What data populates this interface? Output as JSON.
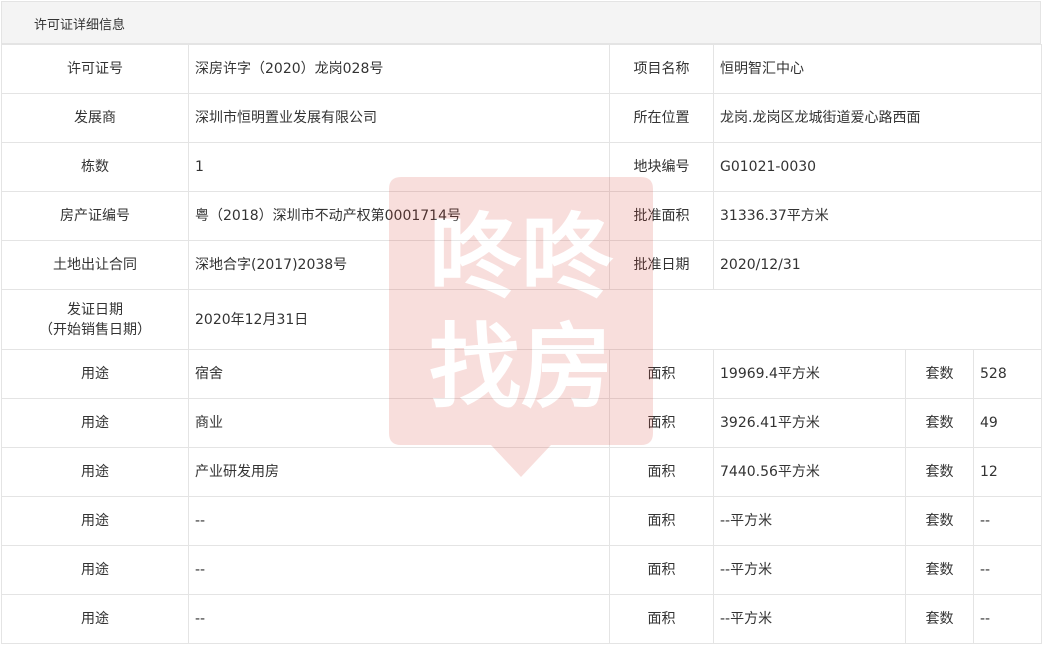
{
  "header": {
    "title": "许可证详细信息"
  },
  "info": {
    "license_no_label": "许可证号",
    "license_no": "深房许字（2020）龙岗028号",
    "project_name_label": "项目名称",
    "project_name": "恒明智汇中心",
    "developer_label": "发展商",
    "developer": "深圳市恒明置业发展有限公司",
    "location_label": "所在位置",
    "location": "龙岗.龙岗区龙城街道爱心路西面",
    "buildings_label": "栋数",
    "buildings": "1",
    "plot_no_label": "地块编号",
    "plot_no": "G01021-0030",
    "property_cert_label": "房产证编号",
    "property_cert": "粤（2018）深圳市不动产权第0001714号",
    "approved_area_label": "批准面积",
    "approved_area": "31336.37平方米",
    "land_contract_label": "土地出让合同",
    "land_contract": "深地合字(2017)2038号",
    "approved_date_label": "批准日期",
    "approved_date": "2020/12/31",
    "issue_date_label_1": "发证日期",
    "issue_date_label_2": "（开始销售日期）",
    "issue_date": "2020年12月31日"
  },
  "usage": {
    "use_label": "用途",
    "area_label": "面积",
    "units_label": "套数",
    "rows": [
      {
        "use": "宿舍",
        "area": "19969.4平方米",
        "units": "528"
      },
      {
        "use": "商业",
        "area": "3926.41平方米",
        "units": "49"
      },
      {
        "use": "产业研发用房",
        "area": "7440.56平方米",
        "units": "12"
      },
      {
        "use": "--",
        "area": "--平方米",
        "units": "--"
      },
      {
        "use": "--",
        "area": "--平方米",
        "units": "--"
      },
      {
        "use": "--",
        "area": "--平方米",
        "units": "--"
      }
    ]
  },
  "watermark": {
    "line1": "咚咚",
    "line2": "找房",
    "color": "#d9362b"
  },
  "colors": {
    "border": "#e4e4e4",
    "header_bg": "#f4f4f4",
    "text": "#333333"
  }
}
